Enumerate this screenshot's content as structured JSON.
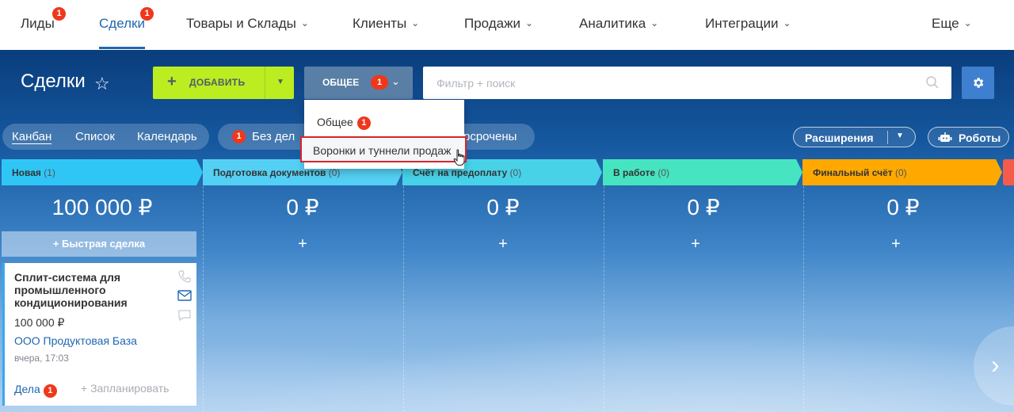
{
  "nav": {
    "items": [
      {
        "label": "Лиды",
        "badge": "1"
      },
      {
        "label": "Сделки",
        "badge": "1"
      },
      {
        "label": "Товары и Склады"
      },
      {
        "label": "Клиенты"
      },
      {
        "label": "Продажи"
      },
      {
        "label": "Аналитика"
      },
      {
        "label": "Интеграции"
      },
      {
        "label": "Еще"
      }
    ],
    "active_index": 1
  },
  "header": {
    "title": "Сделки",
    "add_label": "ДОБАВИТЬ",
    "filter_label": "ОБЩЕЕ",
    "filter_badge": "1",
    "search_placeholder": "Фильтр + поиск"
  },
  "views": {
    "items": [
      "Канбан",
      "Список",
      "Календарь"
    ],
    "active": "Канбан"
  },
  "counters": {
    "badge": "1",
    "label_left": "Без дел",
    "label_right": "рсрочены"
  },
  "toolbar": {
    "extensions_label": "Расширения",
    "robots_label": "Роботы"
  },
  "dropdown": {
    "items": [
      {
        "label": "Общее",
        "badge": "1"
      },
      {
        "label": "Воронки и туннели продаж"
      }
    ],
    "highlighted_index": 1
  },
  "columns": [
    {
      "name": "Новая",
      "count": "(1)",
      "sum": "100 000 ₽",
      "color": "#2fc6f6"
    },
    {
      "name": "Подготовка документов",
      "count": "(0)",
      "sum": "0 ₽",
      "color": "#55d0f5"
    },
    {
      "name": "Счёт на предоплату",
      "count": "(0)",
      "sum": "0 ₽",
      "color": "#47d2e8"
    },
    {
      "name": "В работе",
      "count": "(0)",
      "sum": "0 ₽",
      "color": "#47e4c2"
    },
    {
      "name": "Финальный счёт",
      "count": "(0)",
      "sum": "0 ₽",
      "color": "#ffa900"
    }
  ],
  "quick_deal_label": "+ Быстрая сделка",
  "card": {
    "title": "Сплит-система для промышленного кондиционирования",
    "amount": "100 000 ₽",
    "company": "ООО Продуктовая База",
    "date": "вчера, 17:03",
    "deals_label": "Дела",
    "deals_badge": "1",
    "plan_label": "+ Запланировать"
  },
  "colors": {
    "accent_blue": "#2067b0",
    "add_green": "#bbed21",
    "badge_red": "#f0371b",
    "highlight_border": "#d6252b"
  }
}
